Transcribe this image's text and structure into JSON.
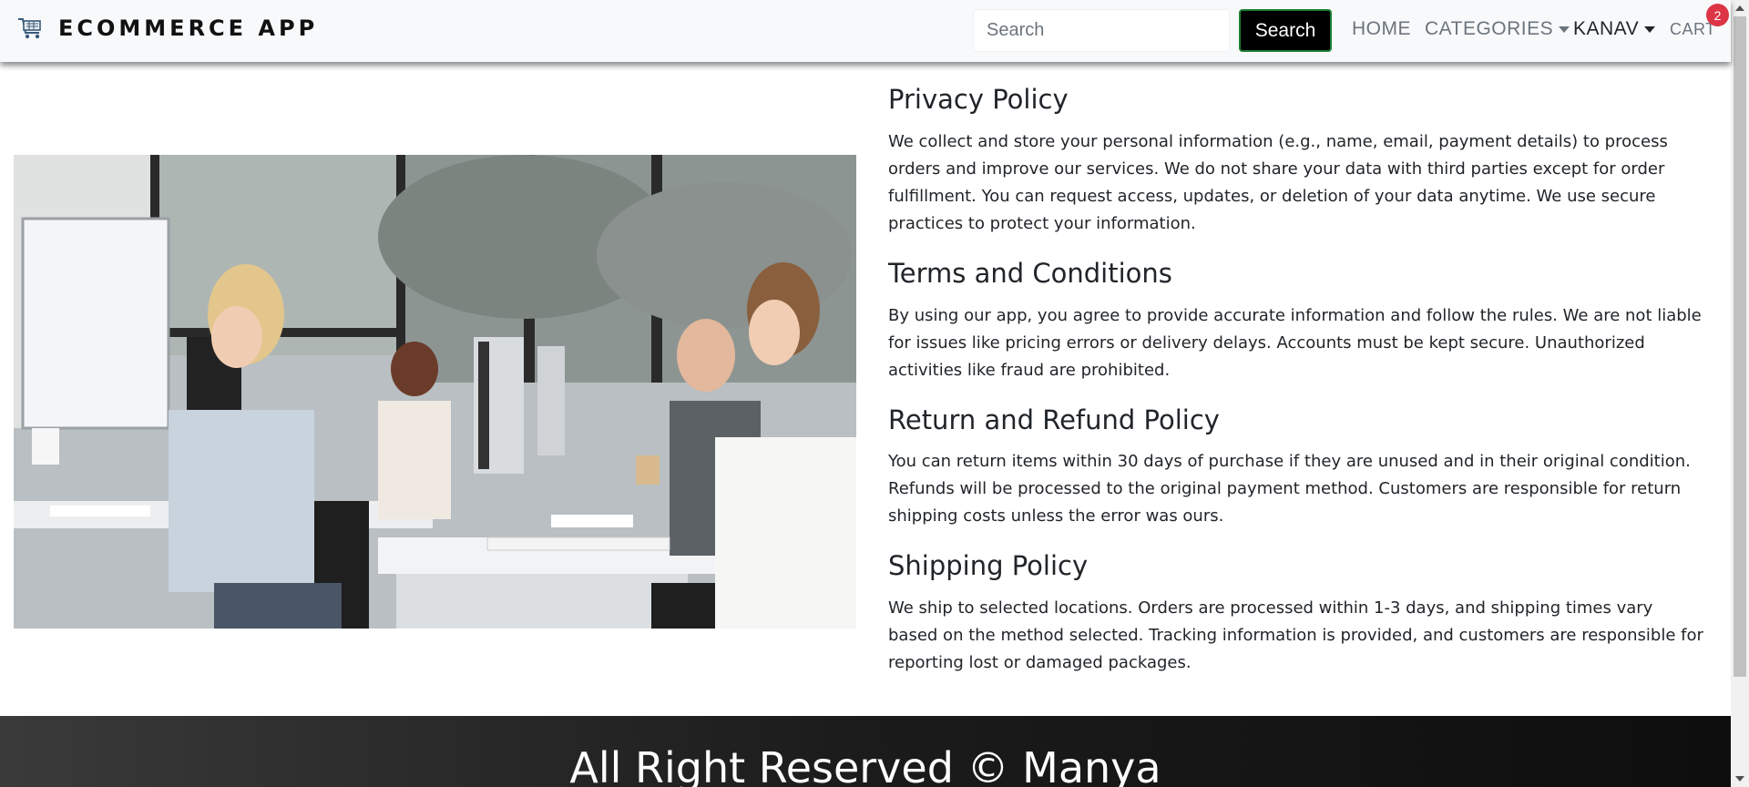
{
  "navbar": {
    "brand": "ECOMMERCE APP",
    "brand_icon": "shopping-cart-icon",
    "search": {
      "placeholder": "Search",
      "value": ""
    },
    "search_button": "Search",
    "links": {
      "home": "HOME",
      "categories": "CATEGORIES",
      "user": "KANAV",
      "cart": "CART"
    },
    "cart_count": "2"
  },
  "main": {
    "image": "customer-support-team-photo",
    "sections": [
      {
        "title": "Privacy Policy",
        "body": "We collect and store your personal information (e.g., name, email, payment details) to process orders and improve our services. We do not share your data with third parties except for order fulfillment. You can request access, updates, or deletion of your data anytime. We use secure practices to protect your information."
      },
      {
        "title": "Terms and Conditions",
        "body": "By using our app, you agree to provide accurate information and follow the rules. We are not liable for issues like pricing errors or delivery delays. Accounts must be kept secure. Unauthorized activities like fraud are prohibited."
      },
      {
        "title": "Return and Refund Policy",
        "body": "You can return items within 30 days of purchase if they are unused and in their original condition. Refunds will be processed to the original payment method. Customers are responsible for return shipping costs unless the error was ours."
      },
      {
        "title": "Shipping Policy",
        "body": "We ship to selected locations. Orders are processed within 1-3 days, and shipping times vary based on the method selected. Tracking information is provided, and customers are responsible for reporting lost or damaged packages."
      }
    ]
  },
  "footer": {
    "text": "All Right Reserved © Manya"
  },
  "colors": {
    "navbar_bg": "#f8f9fa",
    "search_button_bg": "#000000",
    "badge": "#dc3545",
    "footer_bg": "#1b1b1b"
  }
}
